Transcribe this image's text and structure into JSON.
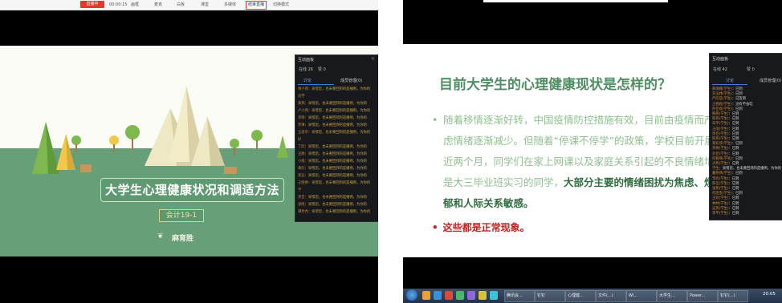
{
  "left": {
    "toolbar": {
      "live_button": "直播中",
      "timer": "00:00:15",
      "items": [
        "画框",
        "麦克",
        "白板",
        "课堂",
        "多媒体",
        "结束直播",
        "切换模式"
      ]
    },
    "slide": {
      "title": "大学生心理健康状况和调适方法",
      "class_label": "会计19-1",
      "author": "麻育胜"
    },
    "panel": {
      "title": "互动面板",
      "online": "在线 26",
      "likes": "赞 0",
      "tab_discuss": "讨论",
      "tab_members": "成员管理(0)",
      "messages": [
        {
          "name": "林小燕",
          "text": "：呆愣您，也未要回到的是播例，为你的"
        },
        {
          "name": "肖",
          "text": "学"
        },
        {
          "name": "黄燕",
          "text": "：呆愣您，也未要回到的是播例，为你的"
        },
        {
          "name": "卢小燕",
          "text": "：呆愣您，也未要回到的是播例，为你的"
        },
        {
          "name": "李晓",
          "text": "：呆愣您，也未要回到的是播例，为你的"
        },
        {
          "name": "罗琳",
          "text": "：呆愣您，也未要回到的是播例，为你的"
        },
        {
          "name": "王思亭",
          "text": "：呆愣您，也未要回到的是播例，为你的"
        },
        {
          "name": "好",
          "text": ""
        },
        {
          "name": "丁欣",
          "text": "：呆愣您，也未要回到的是播例，为你的"
        },
        {
          "name": "王静",
          "text": "：呆愣您，也未要回到的是播例，为你的"
        },
        {
          "name": "小组",
          "text": "：呆愣您，也未要回到的是播例，为你的"
        },
        {
          "name": "黄欣",
          "text": "：呆愣您，也未要回到的是播例，为你的"
        },
        {
          "name": "高远",
          "text": "：呆愣您，也未要回到的是播例，为你的"
        },
        {
          "name": "王晓婷",
          "text": "：呆愣您，也未要回到的是播例，为你的"
        },
        {
          "name": "学",
          "text": ""
        },
        {
          "name": "李佳",
          "text": "：呆愣您，也未要回到的是播例，为你的"
        },
        {
          "name": "张晓",
          "text": "：呆愣您，也未要回到的是播例，为你的"
        },
        {
          "name": "谭秀秀",
          "text": "：呆愣您，也未要回到的是播例，为你的"
        }
      ]
    }
  },
  "right": {
    "slide": {
      "title": "目前大学生的心理健康现状是怎样的？",
      "bullet_lines": [
        "随着移情逐渐好转，中国疫情防控措施有效，目前由疫情而产生",
        "虑情绪逐渐减少。但随着“停课不停学”的政策，学校目前开展",
        "近两个月，同学们在家上网课以及家庭关系引起的不良情绪增多",
        "是大三毕业班实习的同学，"
      ],
      "bold_part_1": "大部分主要的情绪困扰为焦虑、烦躁",
      "bold_part_2": "郁和人际关系敏感。",
      "conclusion": "这些都是正常现象。"
    },
    "panel": {
      "title": "互动面板",
      "online": "在线 42",
      "likes": "赞 0",
      "tab_discuss": "讨论",
      "tab_members": "成员管理(0)",
      "messages": [
        {
          "name": "黄瑞娜(学生)",
          "text": "：已到"
        },
        {
          "name": "刘玉林(学生)",
          "text": "：已到"
        },
        {
          "name": "严欣蕊(学生)",
          "text": "：已签到"
        },
        {
          "name": "王春妮(学生)",
          "text": "：没有不会吃"
        },
        {
          "name": "孙佳欢(学生)",
          "text": "：已到"
        },
        {
          "name": "韩燕(学生)",
          "text": "：已到"
        },
        {
          "name": "陈燕(学生)",
          "text": "：已到"
        },
        {
          "name": "朱平(学生)",
          "text": "：已到"
        },
        {
          "name": "王雨(学生)",
          "text": "：已到"
        },
        {
          "name": "余佳(学生)",
          "text": "：已到"
        },
        {
          "name": "陈燕(学生)",
          "text": "：已到"
        },
        {
          "name": "蒋欢欢(学生)",
          "text": "：已到"
        },
        {
          "name": "李倩(学生)",
          "text": "：已到"
        },
        {
          "name": "刘佳(学生)",
          "text": "：已到"
        },
        {
          "name": "何春燕(学生)",
          "text": "：已到"
        },
        {
          "name": "肖燕(学生)",
          "text": "：已到"
        },
        {
          "name": "学生",
          "text": "：呆愣您，也未要回到的是播例，为你的"
        },
        {
          "name": "董燕燕(学生)",
          "text": "：已到"
        },
        {
          "name": "李欢(学生)",
          "text": "：已到"
        },
        {
          "name": "陈佳(学生)",
          "text": "：已到"
        },
        {
          "name": "张燕(学生)",
          "text": "：已到"
        },
        {
          "name": "何思思(学生)",
          "text": "：已到"
        },
        {
          "name": "王欢(学生)",
          "text": "：已到"
        },
        {
          "name": "林林(学生)",
          "text": "：已到"
        },
        {
          "name": "吴燕(学生)",
          "text": "：已到"
        },
        {
          "name": "李平(学生)",
          "text": "：已到"
        }
      ]
    },
    "taskbar": {
      "tasks": [
        "腾讯会...",
        "钉钉",
        "心理健...",
        "文件(...)",
        "Wi...",
        "大学生...",
        "Power...",
        "钉钉(...)"
      ],
      "clock": "20:05"
    }
  }
}
